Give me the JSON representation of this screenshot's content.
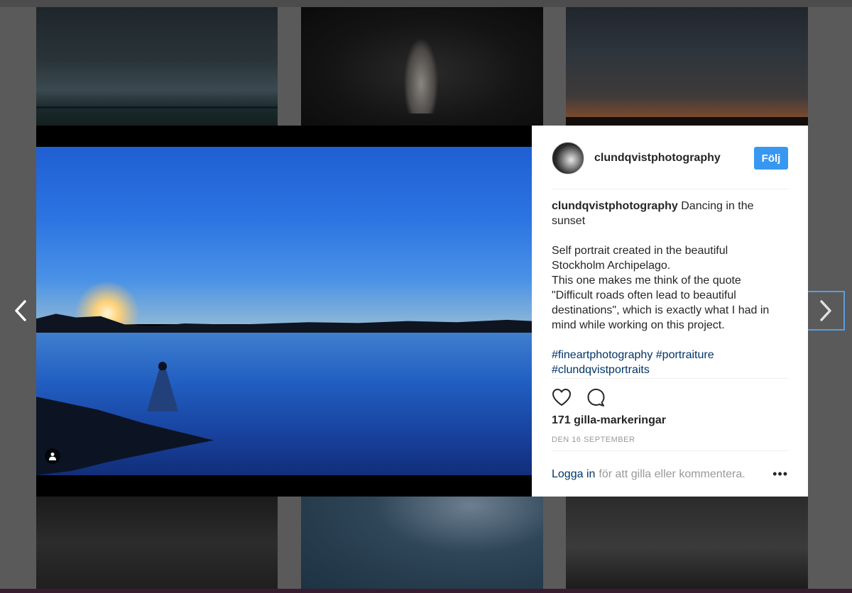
{
  "post": {
    "username": "clundqvistphotography",
    "follow_label": "Följ",
    "caption_user": "clundqvistphotography",
    "caption_title": "Dancing in the sunset",
    "caption_body_lines": [
      "Self portrait created in the beautiful",
      "Stockholm Archipelago.",
      "This one makes me think of the quote",
      "\"Difficult roads often lead to beautiful",
      "destinations\", which is exactly what I had in",
      "mind while working on this project."
    ],
    "hashtags": [
      "#fineartphotography",
      "#portraiture",
      "#clundqvistportraits"
    ],
    "likes_text": "171 gilla-markeringar",
    "date_text": "DEN 16 SEPTEMBER",
    "login_link": "Logga in",
    "login_suffix": "för att gilla eller kommentera.",
    "more_label": "•••"
  },
  "icons": {
    "like": "heart-icon",
    "comment": "comment-icon",
    "user_tag": "user-tag-icon",
    "prev": "chevron-left-icon",
    "next": "chevron-right-icon"
  },
  "colors": {
    "follow_button": "#3897f0",
    "link": "#003569",
    "muted": "#999999"
  }
}
